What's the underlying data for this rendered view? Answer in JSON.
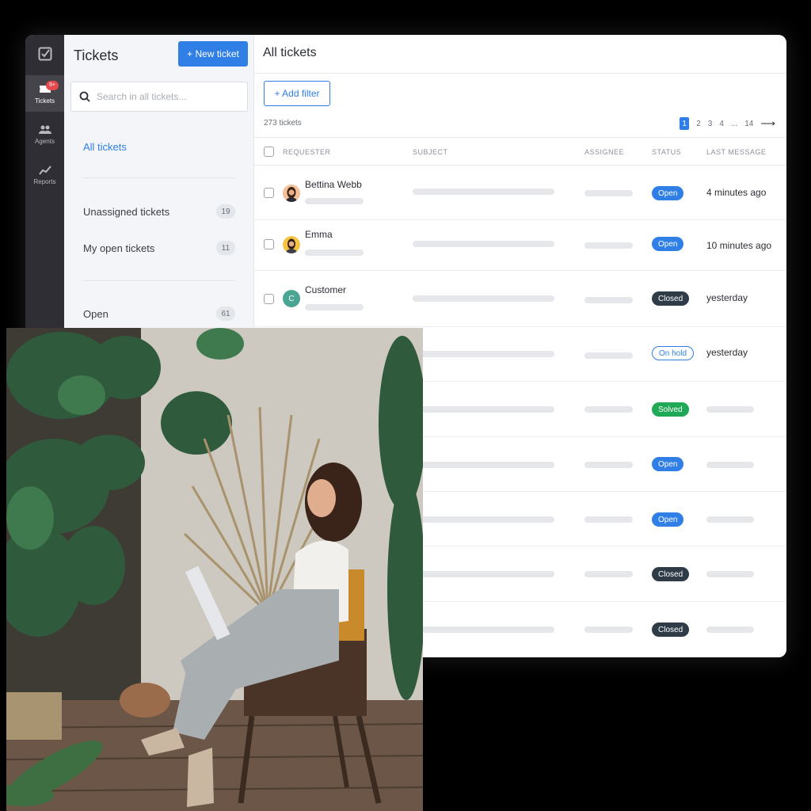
{
  "rail": {
    "items": [
      {
        "label": "Tickets",
        "badge": "9+"
      },
      {
        "label": "Agents"
      },
      {
        "label": "Reports"
      }
    ]
  },
  "sidebar": {
    "title": "Tickets",
    "new_ticket_label": "+ New ticket",
    "search_placeholder": "Search in all tickets...",
    "all_tickets": "All tickets",
    "views": [
      {
        "label": "Unassigned tickets",
        "count": "19"
      },
      {
        "label": "My open tickets",
        "count": "11"
      },
      {
        "label": "Open",
        "count": "61"
      }
    ]
  },
  "main": {
    "title": "All tickets",
    "add_filter_label": "+ Add filter",
    "total": "273 tickets",
    "pagination": {
      "current": "1",
      "pages": [
        "2",
        "3",
        "4"
      ],
      "ellipsis": "...",
      "last": "14",
      "next_arrow": "⟶"
    },
    "columns": [
      "REQUESTER",
      "SUBJECT",
      "ASSIGNEE",
      "STATUS",
      "LAST MESSAGE"
    ],
    "rows": [
      {
        "requester": "Bettina Webb",
        "avatar": "photo",
        "status": "Open",
        "last_message": "4 minutes ago"
      },
      {
        "requester": "Emma",
        "avatar": "photo",
        "status": "Open",
        "last_message": "10 minutes ago"
      },
      {
        "requester": "Customer",
        "avatar": "C",
        "status": "Closed",
        "last_message": "yesterday"
      },
      {
        "requester": "",
        "status": "On hold",
        "last_message": "yesterday"
      },
      {
        "requester": "",
        "status": "Solved",
        "last_message": ""
      },
      {
        "requester": "",
        "status": "Open",
        "last_message": ""
      },
      {
        "requester": "",
        "status": "Open",
        "last_message": ""
      },
      {
        "requester": "",
        "status": "Closed",
        "last_message": ""
      },
      {
        "requester": "",
        "status": "Closed",
        "last_message": ""
      }
    ]
  },
  "colors": {
    "accent": "#2f7fe6",
    "rail_bg": "#2f2e34",
    "status_open": "#2f7fe6",
    "status_closed": "#2f3b47",
    "status_solved": "#1fa855",
    "badge": "#e5484d"
  }
}
